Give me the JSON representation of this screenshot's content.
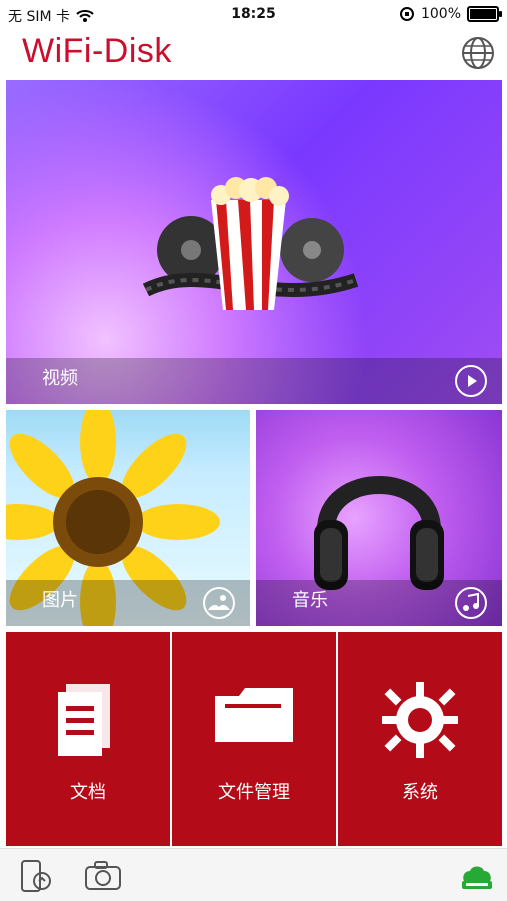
{
  "status_bar": {
    "carrier": "无 SIM 卡",
    "time": "18:25",
    "battery": "100%"
  },
  "header": {
    "title": "WiFi-Disk",
    "globe_icon": "globe-icon"
  },
  "tiles": {
    "video": {
      "label": "视频",
      "icon": "play-icon"
    },
    "photo": {
      "label": "图片",
      "icon": "photo-icon"
    },
    "music": {
      "label": "音乐",
      "icon": "music-note-icon"
    }
  },
  "red_tiles": [
    {
      "label": "文档",
      "icon": "document-icon"
    },
    {
      "label": "文件管理",
      "icon": "folder-icon"
    },
    {
      "label": "系统",
      "icon": "gear-icon"
    }
  ],
  "tabbar": {
    "icons": [
      "phone-sync-icon",
      "camera-icon",
      "cloud-storage-icon"
    ]
  },
  "colors": {
    "brand": "#c8102e",
    "red_tile": "#b40b18",
    "cloud_green": "#26a935"
  }
}
